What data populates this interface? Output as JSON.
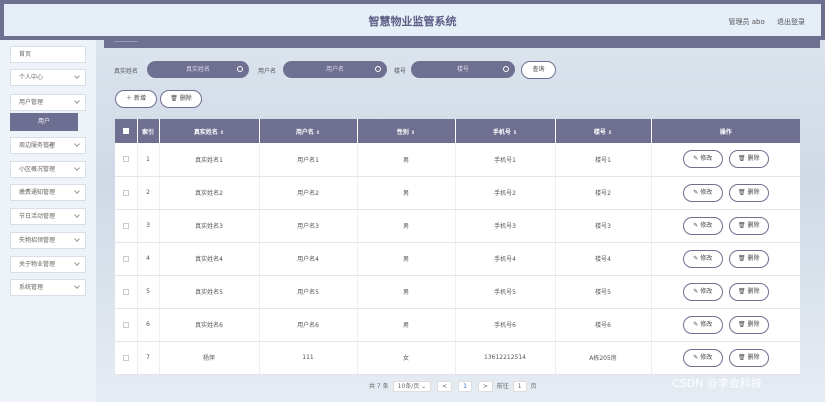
{
  "header": {
    "title": "智慧物业监管系统",
    "user": "管理员 abo",
    "logout": "退出登录"
  },
  "sidebar": {
    "items": [
      {
        "label": "首页"
      },
      {
        "label": "个人中心"
      },
      {
        "label": "用户管理"
      },
      {
        "label": "周边服务管理"
      },
      {
        "label": "小区概况管理"
      },
      {
        "label": "缴费通知管理"
      },
      {
        "label": "节日活动管理"
      },
      {
        "label": "失物招领管理"
      },
      {
        "label": "关于物业管理"
      },
      {
        "label": "系统管理"
      }
    ],
    "sub_item": "用户"
  },
  "search": {
    "realname_label": "真实姓名",
    "realname_placeholder": "真实姓名",
    "username_label": "用户名",
    "username_placeholder": "用户名",
    "building_label": "楼号",
    "building_placeholder": "楼号",
    "button": "查询"
  },
  "toolbar": {
    "add": "新增",
    "delete": "删除"
  },
  "table": {
    "headers": [
      "索引",
      "真实姓名",
      "用户名",
      "性别",
      "手机号",
      "楼号",
      "操作"
    ],
    "edit": "修改",
    "remove": "删除",
    "rows": [
      {
        "index": "1",
        "name": "真实姓名1",
        "user": "用户名1",
        "sex": "男",
        "phone": "手机号1",
        "building": "楼号1"
      },
      {
        "index": "2",
        "name": "真实姓名2",
        "user": "用户名2",
        "sex": "男",
        "phone": "手机号2",
        "building": "楼号2"
      },
      {
        "index": "3",
        "name": "真实姓名3",
        "user": "用户名3",
        "sex": "男",
        "phone": "手机号3",
        "building": "楼号3"
      },
      {
        "index": "4",
        "name": "真实姓名4",
        "user": "用户名4",
        "sex": "男",
        "phone": "手机号4",
        "building": "楼号4"
      },
      {
        "index": "5",
        "name": "真实姓名5",
        "user": "用户名5",
        "sex": "男",
        "phone": "手机号5",
        "building": "楼号5"
      },
      {
        "index": "6",
        "name": "真实姓名6",
        "user": "用户名6",
        "sex": "男",
        "phone": "手机号6",
        "building": "楼号6"
      },
      {
        "index": "7",
        "name": "杨萍",
        "user": "111",
        "sex": "女",
        "phone": "13612212514",
        "building": "A栋205房"
      }
    ]
  },
  "pagination": {
    "total": "共 7 条",
    "page_size": "10条/页",
    "prev": "<",
    "current": "1",
    "next": ">",
    "goto_label": "前往",
    "goto_value": "1",
    "goto_suffix": "页"
  },
  "watermark": "CSDN @李会科技"
}
